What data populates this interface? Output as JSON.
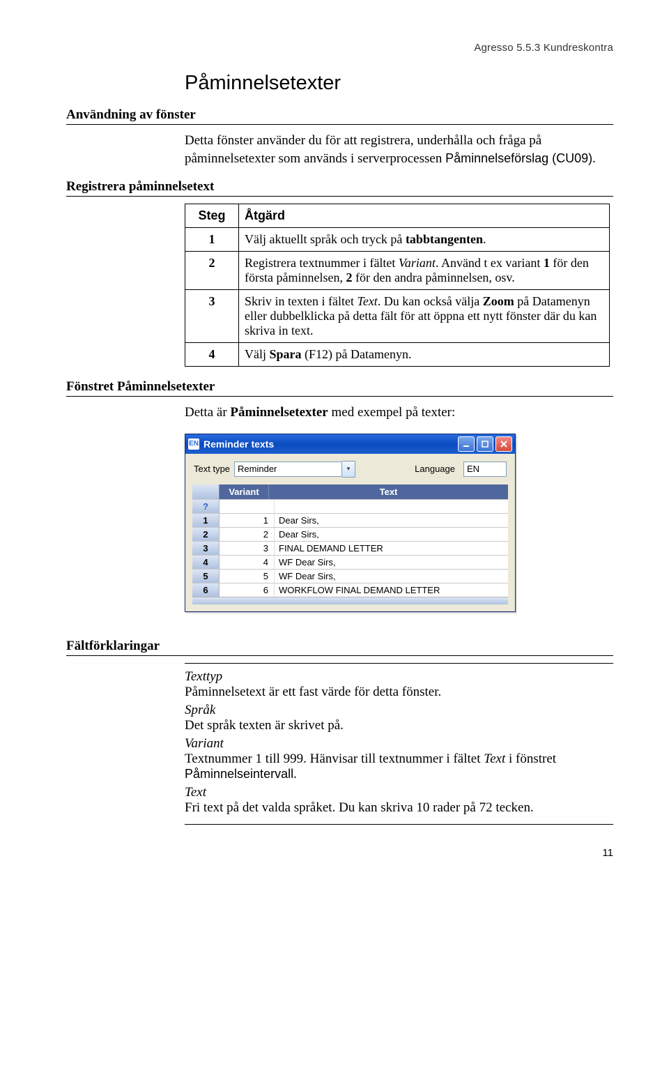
{
  "header": {
    "product": "Agresso 5.5.3 Kundreskontra"
  },
  "title": "Påminnelsetexter",
  "subheads": {
    "usage": "Användning av fönster",
    "register": "Registrera påminnelsetext",
    "window": "Fönstret Påminnelsetexter",
    "fielddefs": "Fältförklaringar"
  },
  "intro": {
    "pre": "Detta fönster använder du för att registrera, underhålla och fråga på påminnelsetexter som används i serverprocessen ",
    "mono": "Påminnelseförslag (CU09)",
    "post": "."
  },
  "steps": {
    "head_step": "Steg",
    "head_action": "Åtgärd",
    "rows": [
      {
        "n": "1",
        "html": "Välj aktuellt språk och tryck på <b>tabbtangenten</b>."
      },
      {
        "n": "2",
        "html": "Registrera textnummer i fältet <i>Variant</i>. Använd t ex variant <b>1</b> för den första påminnelsen, <b>2</b> för den andra påminnelsen, osv."
      },
      {
        "n": "3",
        "html": "Skriv in texten i fältet <i>Text</i>. Du kan också välja <b>Zoom</b> på Datamenyn eller dubbelklicka på detta fält för att öppna ett nytt fönster där du kan skriva in text."
      },
      {
        "n": "4",
        "html": "Välj <b>Spara</b> (F12) på Datamenyn."
      }
    ]
  },
  "example_intro": {
    "pre": "Detta är ",
    "bold": "Påminnelsetexter",
    "post": " med exempel på texter:"
  },
  "window": {
    "title": "Reminder texts",
    "icon_text": "EN",
    "labels": {
      "text_type": "Text type",
      "language": "Language",
      "col_variant": "Variant",
      "col_text": "Text"
    },
    "fields": {
      "text_type_value": "Reminder",
      "language_value": "EN"
    },
    "rows": [
      {
        "idx": "?",
        "variant": "",
        "text": ""
      },
      {
        "idx": "1",
        "variant": "1",
        "text": "Dear Sirs,"
      },
      {
        "idx": "2",
        "variant": "2",
        "text": "Dear Sirs,"
      },
      {
        "idx": "3",
        "variant": "3",
        "text": "FINAL DEMAND LETTER"
      },
      {
        "idx": "4",
        "variant": "4",
        "text": "WF Dear Sirs,"
      },
      {
        "idx": "5",
        "variant": "5",
        "text": "WF Dear Sirs,"
      },
      {
        "idx": "6",
        "variant": "6",
        "text": "WORKFLOW FINAL DEMAND LETTER"
      }
    ]
  },
  "fielddefs": [
    {
      "term": "Texttyp",
      "desc": "Påminnelsetext är ett fast värde för detta fönster."
    },
    {
      "term": "Språk",
      "desc": "Det språk texten är skrivet på."
    },
    {
      "term": "Variant",
      "desc_html": "Textnummer 1 till 999. Hänvisar till textnummer i fältet <i>Text</i> i fönstret <span class=\"mono\">Påminnelseintervall</span>."
    },
    {
      "term": "Text",
      "desc": "Fri text på det valda språket. Du kan skriva 10 rader på 72 tecken."
    }
  ],
  "page_number": "11"
}
